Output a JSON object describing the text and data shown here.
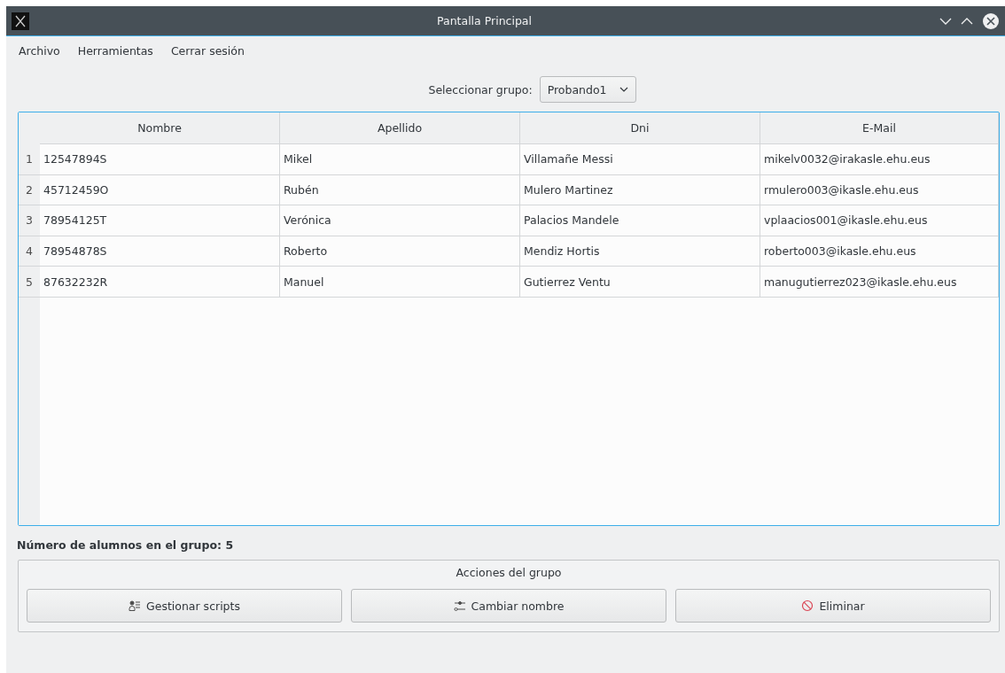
{
  "window": {
    "title": "Pantalla Principal"
  },
  "menu": [
    "Archivo",
    "Herramientas",
    "Cerrar sesión"
  ],
  "group_select": {
    "label": "Seleccionar grupo:",
    "value": "Probando1"
  },
  "table": {
    "columns": [
      "Nombre",
      "Apellido",
      "Dni",
      "E-Mail"
    ],
    "rows": [
      {
        "number": "1",
        "cells": [
          "12547894S",
          "Mikel",
          "Villamañe Messi",
          "mikelv0032@irakasle.ehu.eus"
        ]
      },
      {
        "number": "2",
        "cells": [
          "45712459O",
          "Rubén",
          "Mulero Martinez",
          "rmulero003@ikasle.ehu.eus"
        ]
      },
      {
        "number": "3",
        "cells": [
          "78954125T",
          "Verónica",
          "Palacios Mandele",
          "vplaacios001@ikasle.ehu.eus"
        ]
      },
      {
        "number": "4",
        "cells": [
          "78954878S",
          "Roberto",
          "Mendiz Hortis",
          "roberto003@ikasle.ehu.eus"
        ]
      },
      {
        "number": "5",
        "cells": [
          "87632232R",
          "Manuel",
          "Gutierrez Ventu",
          "manugutierrez023@ikasle.ehu.eus"
        ]
      }
    ]
  },
  "student_count": "Número de alumnos en el grupo: 5",
  "actions": {
    "title": "Acciones del grupo",
    "buttons": [
      "Gestionar scripts",
      "Cambiar nombre",
      "Eliminar"
    ]
  }
}
